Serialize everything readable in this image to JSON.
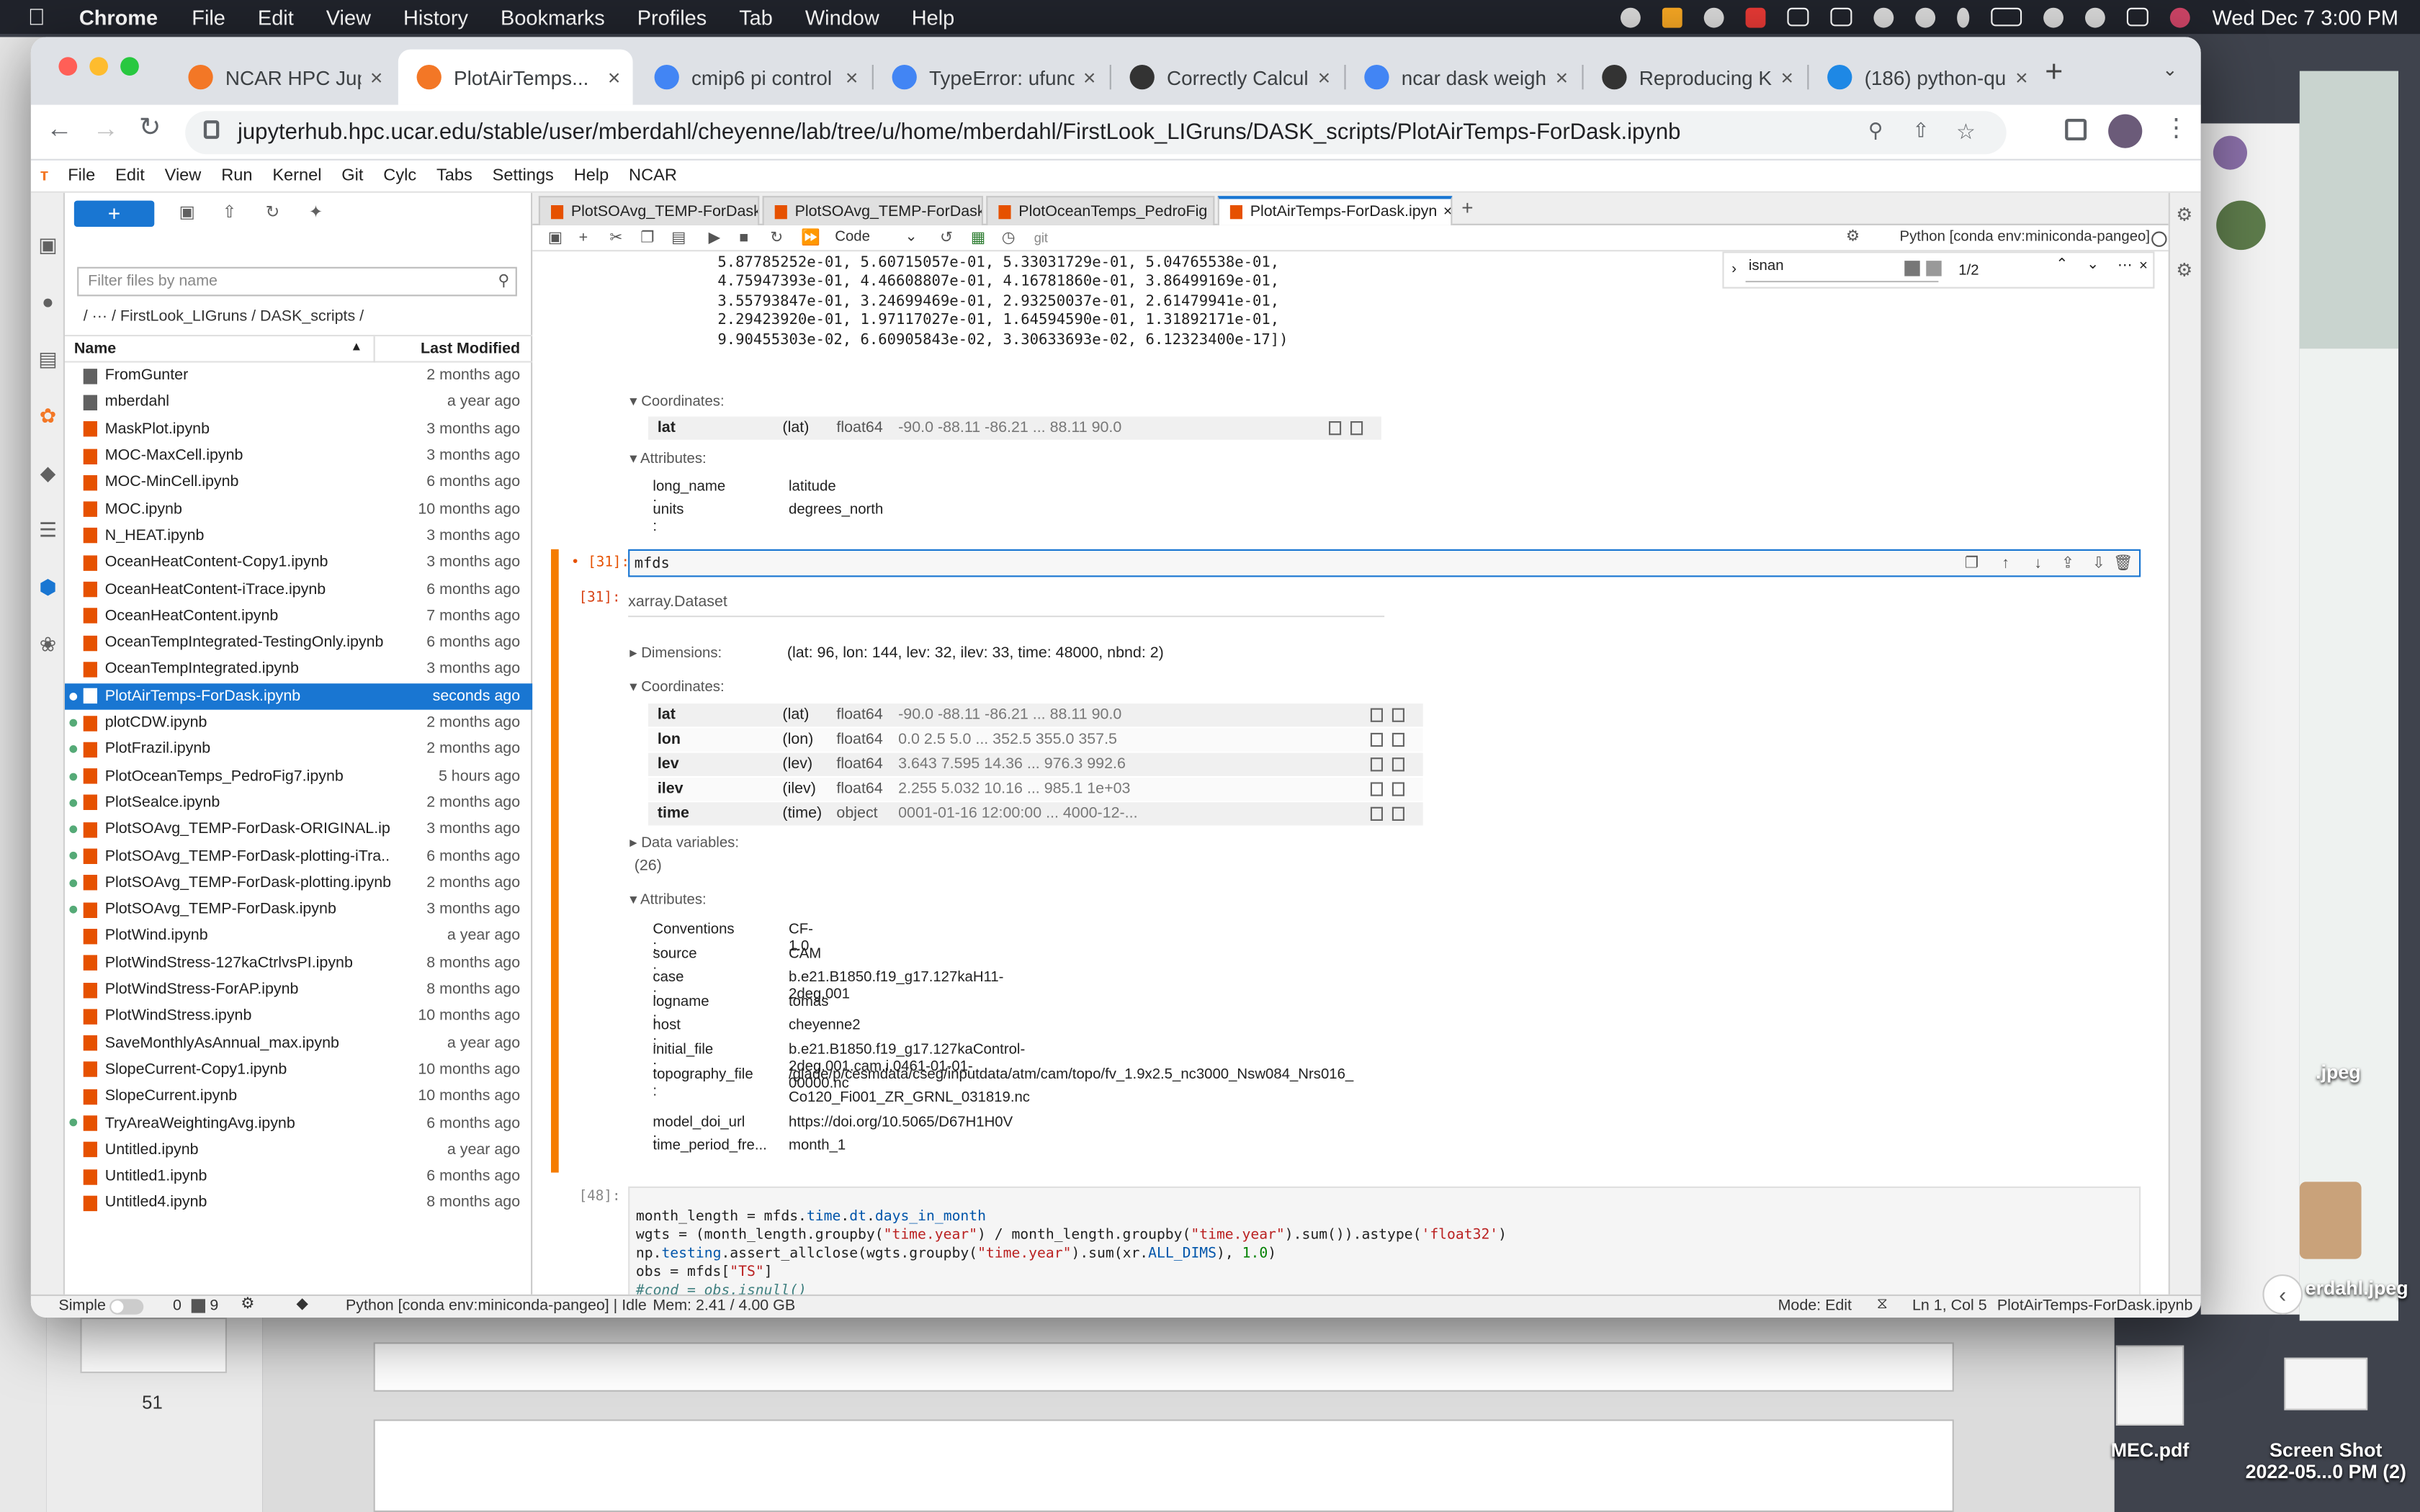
{
  "macmenu": {
    "apple": "",
    "app": "Chrome",
    "items": [
      "File",
      "Edit",
      "View",
      "History",
      "Bookmarks",
      "Profiles",
      "Tab",
      "Window",
      "Help"
    ],
    "clock": "Wed Dec 7  3:00 PM"
  },
  "browser": {
    "tabs": [
      {
        "title": "NCAR HPC Jupyt",
        "color": "#f37726"
      },
      {
        "title": "PlotAirTemps...",
        "color": "#f37726"
      },
      {
        "title": "cmip6 pi control",
        "color": "#4285f4"
      },
      {
        "title": "TypeError: ufunc",
        "color": "#4285f4"
      },
      {
        "title": "Correctly Calcula",
        "color": "#333333"
      },
      {
        "title": "ncar dask weight",
        "color": "#4285f4"
      },
      {
        "title": "Reproducing Key",
        "color": "#333333"
      },
      {
        "title": "(186) python-qu",
        "color": "#1e88e5"
      }
    ],
    "url": "jupyterhub.hpc.ucar.edu/stable/user/mberdahl/cheyenne/lab/tree/u/home/mberdahl/FirstLook_LIGruns/DASK_scripts/PlotAirTemps-ForDask.ipynb"
  },
  "jupyter": {
    "menu": [
      "File",
      "Edit",
      "View",
      "Run",
      "Kernel",
      "Git",
      "Cylc",
      "Tabs",
      "Settings",
      "Help",
      "NCAR"
    ],
    "filebrowser": {
      "filter_placeholder": "Filter files by name",
      "crumb": "/  ···  / FirstLook_LIGruns / DASK_scripts /",
      "col_name": "Name",
      "col_modified": "Last Modified",
      "files": [
        {
          "name": "FromGunter",
          "mod": "2 months ago",
          "type": "folder",
          "run": false
        },
        {
          "name": "mberdahl",
          "mod": "a year ago",
          "type": "folder",
          "run": false
        },
        {
          "name": "MaskPlot.ipynb",
          "mod": "3 months ago",
          "type": "nb",
          "run": false
        },
        {
          "name": "MOC-MaxCell.ipynb",
          "mod": "3 months ago",
          "type": "nb",
          "run": false
        },
        {
          "name": "MOC-MinCell.ipynb",
          "mod": "6 months ago",
          "type": "nb",
          "run": false
        },
        {
          "name": "MOC.ipynb",
          "mod": "10 months ago",
          "type": "nb",
          "run": false
        },
        {
          "name": "N_HEAT.ipynb",
          "mod": "3 months ago",
          "type": "nb",
          "run": false
        },
        {
          "name": "OceanHeatContent-Copy1.ipynb",
          "mod": "3 months ago",
          "type": "nb",
          "run": false
        },
        {
          "name": "OceanHeatContent-iTrace.ipynb",
          "mod": "6 months ago",
          "type": "nb",
          "run": false
        },
        {
          "name": "OceanHeatContent.ipynb",
          "mod": "7 months ago",
          "type": "nb",
          "run": false
        },
        {
          "name": "OceanTempIntegrated-TestingOnly.ipynb",
          "mod": "6 months ago",
          "type": "nb",
          "run": false
        },
        {
          "name": "OceanTempIntegrated.ipynb",
          "mod": "3 months ago",
          "type": "nb",
          "run": false
        },
        {
          "name": "PlotAirTemps-ForDask.ipynb",
          "mod": "seconds ago",
          "type": "nb",
          "run": true,
          "selected": true
        },
        {
          "name": "plotCDW.ipynb",
          "mod": "2 months ago",
          "type": "nb",
          "run": true
        },
        {
          "name": "PlotFrazil.ipynb",
          "mod": "2 months ago",
          "type": "nb",
          "run": true
        },
        {
          "name": "PlotOceanTemps_PedroFig7.ipynb",
          "mod": "5 hours ago",
          "type": "nb",
          "run": true
        },
        {
          "name": "PlotSealce.ipynb",
          "mod": "2 months ago",
          "type": "nb",
          "run": true
        },
        {
          "name": "PlotSOAvg_TEMP-ForDask-ORIGINAL.ip...",
          "mod": "3 months ago",
          "type": "nb",
          "run": true
        },
        {
          "name": "PlotSOAvg_TEMP-ForDask-plotting-iTra...",
          "mod": "6 months ago",
          "type": "nb",
          "run": true
        },
        {
          "name": "PlotSOAvg_TEMP-ForDask-plotting.ipynb",
          "mod": "2 months ago",
          "type": "nb",
          "run": true
        },
        {
          "name": "PlotSOAvg_TEMP-ForDask.ipynb",
          "mod": "3 months ago",
          "type": "nb",
          "run": true
        },
        {
          "name": "PlotWind.ipynb",
          "mod": "a year ago",
          "type": "nb",
          "run": false
        },
        {
          "name": "PlotWindStress-127kaCtrlvsPI.ipynb",
          "mod": "8 months ago",
          "type": "nb",
          "run": false
        },
        {
          "name": "PlotWindStress-ForAP.ipynb",
          "mod": "8 months ago",
          "type": "nb",
          "run": false
        },
        {
          "name": "PlotWindStress.ipynb",
          "mod": "10 months ago",
          "type": "nb",
          "run": false
        },
        {
          "name": "SaveMonthlyAsAnnual_max.ipynb",
          "mod": "a year ago",
          "type": "nb",
          "run": false
        },
        {
          "name": "SlopeCurrent-Copy1.ipynb",
          "mod": "10 months ago",
          "type": "nb",
          "run": false
        },
        {
          "name": "SlopeCurrent.ipynb",
          "mod": "10 months ago",
          "type": "nb",
          "run": false
        },
        {
          "name": "TryAreaWeightingAvg.ipynb",
          "mod": "6 months ago",
          "type": "nb",
          "run": true
        },
        {
          "name": "Untitled.ipynb",
          "mod": "a year ago",
          "type": "nb",
          "run": false
        },
        {
          "name": "Untitled1.ipynb",
          "mod": "6 months ago",
          "type": "nb",
          "run": false
        },
        {
          "name": "Untitled4.ipynb",
          "mod": "8 months ago",
          "type": "nb",
          "run": false
        }
      ]
    },
    "doc_tabs": [
      "PlotSOAvg_TEMP-ForDask",
      "PlotSOAvg_TEMP-ForDask",
      "PlotOceanTemps_PedroFig",
      "PlotAirTemps-ForDask.ipyn"
    ],
    "cell_type": "Code",
    "git": "git",
    "kernel": "Python [conda env:miniconda-pangeo]",
    "find": {
      "query": "isnan",
      "count": "1/2"
    },
    "array_lines": [
      "5.87785252e-01, 5.60715057e-01, 5.33031729e-01, 5.04765538e-01,",
      "4.75947393e-01, 4.46608807e-01, 4.16781860e-01, 3.86499169e-01,",
      "3.55793847e-01, 3.24699469e-01, 2.93250037e-01, 2.61479941e-01,",
      "2.29423920e-01, 1.97117027e-01, 1.64594590e-01, 1.31892171e-01,",
      "9.90455303e-02, 6.60905843e-02, 3.30633693e-02, 6.12323400e-17])"
    ],
    "prev": {
      "coord_label": "Coordinates:",
      "coord": {
        "name": "lat",
        "dim": "(lat)",
        "dtype": "float64",
        "vals": "-90.0 -88.11 -86.21 ... 88.11 90.0"
      },
      "attr_label": "Attributes:",
      "attrs": [
        {
          "k": "long_name :",
          "v": "latitude"
        },
        {
          "k": "units :",
          "v": "degrees_north"
        }
      ]
    },
    "cell31": {
      "prompt": "[31]:",
      "code": "mfds"
    },
    "out31": {
      "prompt": "[31]:",
      "type": "xarray.Dataset",
      "dims_label": "Dimensions:",
      "dims": "(lat: 96, lon: 144, lev: 32, ilev: 33, time: 48000, nbnd: 2)",
      "coord_label": "Coordinates:",
      "coords": [
        {
          "name": "lat",
          "dim": "(lat)",
          "dtype": "float64",
          "vals": "-90.0 -88.11 -86.21 ... 88.11 90.0"
        },
        {
          "name": "lon",
          "dim": "(lon)",
          "dtype": "float64",
          "vals": "0.0 2.5 5.0 ... 352.5 355.0 357.5"
        },
        {
          "name": "lev",
          "dim": "(lev)",
          "dtype": "float64",
          "vals": "3.643 7.595 14.36 ... 976.3 992.6"
        },
        {
          "name": "ilev",
          "dim": "(ilev)",
          "dtype": "float64",
          "vals": "2.255 5.032 10.16 ... 985.1 1e+03"
        },
        {
          "name": "time",
          "dim": "(time)",
          "dtype": "object",
          "vals": "0001-01-16 12:00:00 ... 4000-12-..."
        }
      ],
      "datavars_label": "Data variables:",
      "datavars_count": "(26)",
      "attr_label": "Attributes:",
      "attrs": [
        {
          "k": "Conventions :",
          "v": "CF-1.0"
        },
        {
          "k": "source :",
          "v": "CAM"
        },
        {
          "k": "case :",
          "v": "b.e21.B1850.f19_g17.127kaH11-2deg.001"
        },
        {
          "k": "logname :",
          "v": "tomas"
        },
        {
          "k": "host :",
          "v": "cheyenne2"
        },
        {
          "k": "initial_file :",
          "v": "b.e21.B1850.f19_g17.127kaControl-2deg.001.cam.i.0461-01-01-00000.nc"
        },
        {
          "k": "topography_file :",
          "v": "/glade/p/cesmdata/cseg/inputdata/atm/cam/topo/fv_1.9x2.5_nc3000_Nsw084_Nrs016_"
        },
        {
          "k": "",
          "v": "Co120_Fi001_ZR_GRNL_031819.nc"
        },
        {
          "k": "model_doi_url :",
          "v": "https://doi.org/10.5065/D67H1H0V"
        },
        {
          "k": "time_period_fre...",
          "v": "month_1"
        }
      ]
    },
    "cell48": {
      "prompt": "[48]:"
    },
    "status": {
      "mode": "Simple",
      "counts": "0",
      "terms": "9",
      "kernel_state": "Python [conda env:miniconda-pangeo] | Idle",
      "mem": "Mem: 2.41 / 4.00 GB",
      "edit_mode": "Mode: Edit",
      "pos": "Ln 1, Col 5",
      "file": "PlotAirTemps-ForDask.ipynb"
    }
  },
  "desktop": {
    "labels": [
      "MEC.pdf",
      "Screen Shot\n2022-05...0 PM (2)",
      "erdahl.jpeg",
      ".jpeg",
      "51"
    ]
  }
}
